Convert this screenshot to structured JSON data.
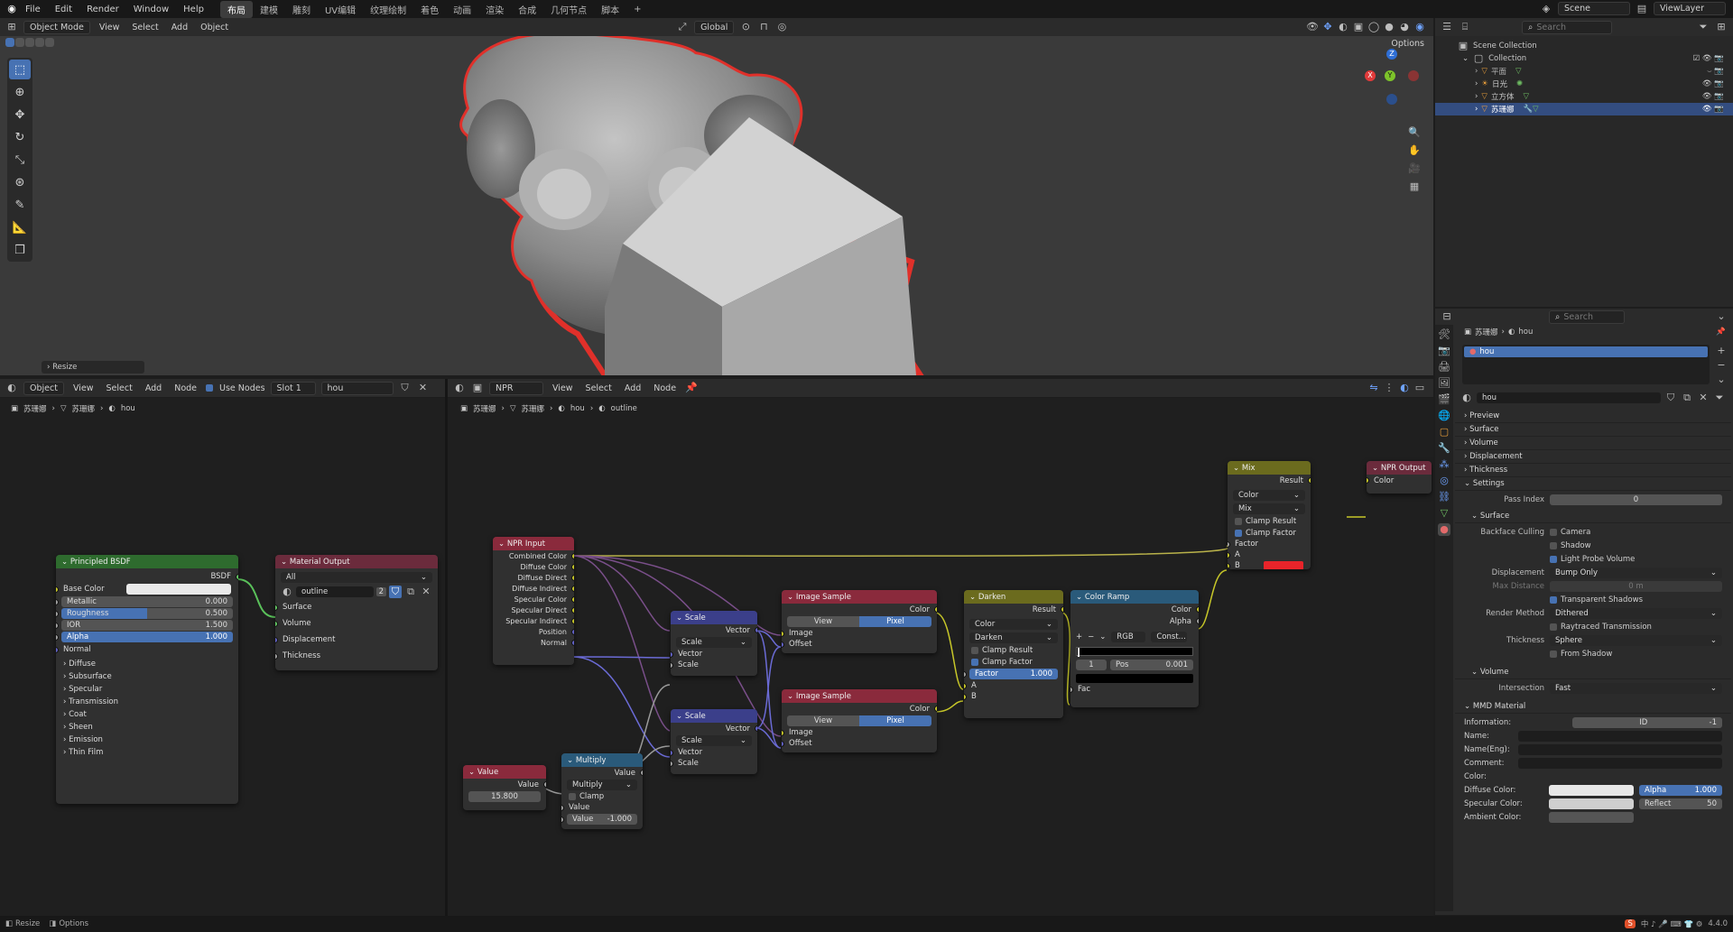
{
  "menubar": {
    "items": [
      "File",
      "Edit",
      "Render",
      "Window",
      "Help"
    ],
    "workspaces": [
      "布局",
      "建模",
      "雕刻",
      "UV编辑",
      "纹理绘制",
      "着色",
      "动画",
      "渲染",
      "合成",
      "几何节点",
      "脚本"
    ],
    "active_workspace": "布局",
    "scene": "Scene",
    "viewlayer": "ViewLayer"
  },
  "viewport": {
    "mode": "Object Mode",
    "menus": [
      "View",
      "Select",
      "Add",
      "Object"
    ],
    "transform": "Global",
    "options": "Options",
    "resize_label": "Resize",
    "outline_color": "#e0302a"
  },
  "outliner": {
    "search_placeholder": "Search",
    "scene_collection": "Scene Collection",
    "collection": "Collection",
    "items": [
      "平面",
      "日光",
      "立方体",
      "苏珊娜"
    ]
  },
  "left_editor": {
    "mode": "Object",
    "menus": [
      "View",
      "Select",
      "Add",
      "Node"
    ],
    "use_nodes": "Use Nodes",
    "slot": "Slot 1",
    "material": "hou",
    "breadcrumb": [
      "苏珊娜",
      "苏珊娜",
      "hou"
    ]
  },
  "right_editor": {
    "tree": "NPR",
    "menus": [
      "View",
      "Select",
      "Add",
      "Node"
    ],
    "breadcrumb": [
      "苏珊娜",
      "苏珊娜",
      "hou",
      "outline"
    ]
  },
  "bsdf": {
    "title": "Principled BSDF",
    "out": "BSDF",
    "base_color": "Base Color",
    "metallic": {
      "label": "Metallic",
      "value": "0.000"
    },
    "roughness": {
      "label": "Roughness",
      "value": "0.500",
      "fill": 0.5
    },
    "ior": {
      "label": "IOR",
      "value": "1.500"
    },
    "alpha": {
      "label": "Alpha",
      "value": "1.000",
      "fill": 1
    },
    "normal": "Normal",
    "panels": [
      "Diffuse",
      "Subsurface",
      "Specular",
      "Transmission",
      "Coat",
      "Sheen",
      "Emission",
      "Thin Film"
    ]
  },
  "matout": {
    "title": "Material Output",
    "target": "All",
    "group": "outline",
    "users": "2",
    "inputs": [
      "Surface",
      "Volume",
      "Displacement",
      "Thickness"
    ]
  },
  "npr_input": {
    "title": "NPR Input",
    "outputs": [
      "Combined Color",
      "Diffuse Color",
      "Diffuse Direct",
      "Diffuse Indirect",
      "Specular Color",
      "Specular Direct",
      "Specular Indirect",
      "Position",
      "Normal"
    ]
  },
  "scale1": {
    "title": "Scale",
    "out": "Vector",
    "mode": "Scale",
    "inputs": [
      "Vector",
      "Scale"
    ]
  },
  "scale2": {
    "title": "Scale",
    "out": "Vector",
    "mode": "Scale",
    "inputs": [
      "Vector",
      "Scale"
    ]
  },
  "value_node": {
    "title": "Value",
    "out": "Value",
    "value": "15.800"
  },
  "multiply": {
    "title": "Multiply",
    "out": "Value",
    "op": "Multiply",
    "clamp": "Clamp",
    "in": "Value",
    "value_label": "Value",
    "value": "-1.000"
  },
  "img1": {
    "title": "Image Sample",
    "out": "Color",
    "view": "View",
    "pixel": "Pixel",
    "inputs": [
      "Image",
      "Offset"
    ]
  },
  "img2": {
    "title": "Image Sample",
    "out": "Color",
    "view": "View",
    "pixel": "Pixel",
    "inputs": [
      "Image",
      "Offset"
    ]
  },
  "darken": {
    "title": "Darken",
    "out": "Result",
    "type": "Color",
    "blend": "Darken",
    "clamp_result": "Clamp Result",
    "clamp_factor": "Clamp Factor",
    "factor_label": "Factor",
    "factor": "1.000",
    "a": "A",
    "b": "B"
  },
  "ramp": {
    "title": "Color Ramp",
    "outs": [
      "Color",
      "Alpha"
    ],
    "mode": "RGB",
    "interp": "Const...",
    "index": "1",
    "pos_label": "Pos",
    "pos": "0.001",
    "fac": "Fac"
  },
  "mix": {
    "title": "Mix",
    "out": "Result",
    "type": "Color",
    "blend": "Mix",
    "clamp_result": "Clamp Result",
    "clamp_factor": "Clamp Factor",
    "factor": "Factor",
    "a": "A",
    "b": "B",
    "b_color": "#e8242a"
  },
  "npr_output": {
    "title": "NPR Output",
    "in": "Color"
  },
  "props": {
    "search_placeholder": "Search",
    "breadcrumb": [
      "苏珊娜",
      "hou"
    ],
    "slot": "hou",
    "material": "hou",
    "sections": [
      "Preview",
      "Surface",
      "Volume",
      "Displacement",
      "Thickness"
    ],
    "settings": "Settings",
    "pass_index_label": "Pass Index",
    "pass_index": "0",
    "surface": "Surface",
    "backface_label": "Backface Culling",
    "camera": "Camera",
    "shadow": "Shadow",
    "light_probe": "Light Probe Volume",
    "disp_label": "Displacement",
    "disp_value": "Bump Only",
    "max_dist_label": "Max Distance",
    "max_dist": "0 m",
    "transparent_shadows": "Transparent Shadows",
    "render_method_label": "Render Method",
    "render_method": "Dithered",
    "raytraced": "Raytraced Transmission",
    "thickness_label": "Thickness",
    "thickness": "Sphere",
    "from_shadow": "From Shadow",
    "volume": "Volume",
    "intersection_label": "Intersection",
    "intersection": "Fast",
    "mmd": "MMD Material",
    "information_label": "Information:",
    "id_label": "ID",
    "id_value": "-1",
    "name_label": "Name:",
    "name_eng_label": "Name(Eng):",
    "comment_label": "Comment:",
    "color_label": "Color:",
    "diffuse_label": "Diffuse Color:",
    "specular_label": "Specular Color:",
    "ambient_label": "Ambient Color:",
    "alpha_label": "Alpha",
    "alpha_value": "1.000",
    "reflect_label": "Reflect",
    "reflect_value": "50"
  },
  "status": {
    "resize": "Resize",
    "options": "Options",
    "version": "4.4.0"
  }
}
